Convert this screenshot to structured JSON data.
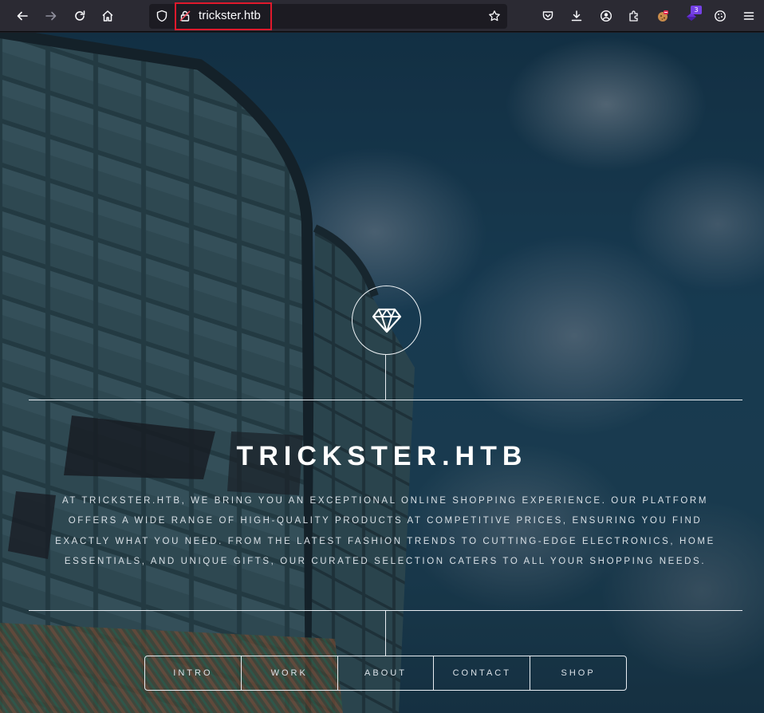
{
  "browser": {
    "url": "trickster.htb",
    "toolbar_icons": [
      "back-arrow-icon",
      "forward-arrow-icon",
      "reload-icon",
      "home-icon",
      "shield-icon",
      "insecure-lock-icon",
      "bookmark-star-icon",
      "pocket-icon",
      "download-icon",
      "account-icon",
      "extensions-icon",
      "extension-cookie-icon",
      "extension-wappalyzer-icon",
      "cookie-icon",
      "menu-icon"
    ],
    "extension_badge": "3"
  },
  "site": {
    "title": "TRICKSTER.HTB",
    "description": "At Trickster.htb, we bring you an exceptional online shopping experience. Our platform offers a wide range of high-quality products at competitive prices, ensuring you find exactly what you need. From the latest fashion trends to cutting-edge electronics, home essentials, and unique gifts, our curated selection caters to all your shopping needs.",
    "logo_icon": "diamond-icon",
    "nav": [
      {
        "label": "INTRO"
      },
      {
        "label": "WORK"
      },
      {
        "label": "ABOUT"
      },
      {
        "label": "CONTACT"
      },
      {
        "label": "SHOP"
      }
    ]
  },
  "colors": {
    "toolbar_bg": "#2b2a33",
    "urlbar_bg": "#1c1b22",
    "url_highlight": "#e0192c",
    "text_light": "#ffffff"
  }
}
